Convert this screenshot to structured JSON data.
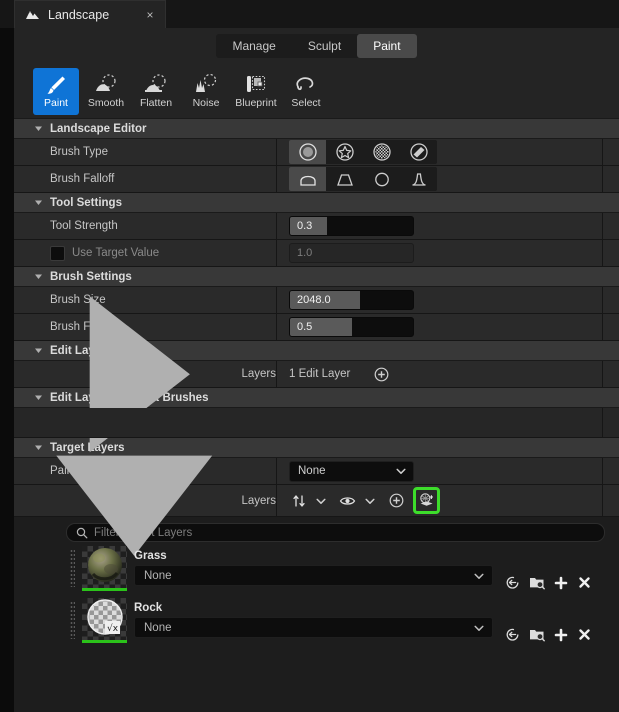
{
  "tab": {
    "title": "Landscape",
    "icon": "landscape-mountain-icon",
    "close": "×"
  },
  "modes": {
    "items": [
      {
        "label": "Manage",
        "active": false
      },
      {
        "label": "Sculpt",
        "active": false
      },
      {
        "label": "Paint",
        "active": true
      }
    ]
  },
  "tools": {
    "items": [
      {
        "label": "Paint",
        "icon": "paint-brush-icon",
        "active": true
      },
      {
        "label": "Smooth",
        "icon": "smooth-icon",
        "active": false
      },
      {
        "label": "Flatten",
        "icon": "flatten-icon",
        "active": false
      },
      {
        "label": "Noise",
        "icon": "noise-icon",
        "active": false
      },
      {
        "label": "Blueprint",
        "icon": "blueprint-icon",
        "active": false
      },
      {
        "label": "Select",
        "icon": "select-lasso-icon",
        "active": false
      }
    ]
  },
  "sections": {
    "landscape_editor": "Landscape Editor",
    "tool_settings": "Tool Settings",
    "brush_settings": "Brush Settings",
    "edit_layers": "Edit Layers",
    "edit_layer_bp_brushes": "Edit Layer Blueprint Brushes",
    "target_layers": "Target Layers"
  },
  "properties": {
    "brush_type": {
      "label": "Brush Type",
      "options": [
        {
          "icon": "brush-circle-icon",
          "active": true
        },
        {
          "icon": "brush-alpha-icon",
          "active": false
        },
        {
          "icon": "brush-pattern-icon",
          "active": false
        },
        {
          "icon": "brush-component-icon",
          "active": false
        }
      ]
    },
    "brush_falloff_type": {
      "label": "Brush Falloff",
      "options": [
        {
          "icon": "falloff-smooth-icon",
          "active": true
        },
        {
          "icon": "falloff-linear-icon",
          "active": false
        },
        {
          "icon": "falloff-spherical-icon",
          "active": false
        },
        {
          "icon": "falloff-tip-icon",
          "active": false
        }
      ]
    },
    "tool_strength": {
      "label": "Tool Strength",
      "value": "0.3",
      "fill_pct": 30
    },
    "use_target_value": {
      "label": "Use Target Value",
      "checked": false,
      "value": "1.0"
    },
    "brush_size": {
      "label": "Brush Size",
      "value": "2048.0",
      "fill_pct": 57
    },
    "brush_falloff": {
      "label": "Brush Falloff",
      "value": "0.5",
      "fill_pct": 50
    },
    "layers_edit": {
      "label": "Layers",
      "value": "1 Edit Layer",
      "add_icon": "plus-circle-icon"
    },
    "painting_restriction": {
      "label": "Painting Restriction",
      "value": "None"
    },
    "layers_target": {
      "label": "Layers",
      "tools": [
        {
          "icon": "sort-icon",
          "name": "sort-button"
        },
        {
          "icon": "chevron-down-icon",
          "name": "sort-dropdown"
        },
        {
          "icon": "eye-icon",
          "name": "visibility-button"
        },
        {
          "icon": "chevron-down-icon",
          "name": "visibility-dropdown"
        },
        {
          "icon": "plus-circle-icon",
          "name": "add-layer-button"
        },
        {
          "icon": "layers-stack-icon",
          "name": "target-layer-options-button",
          "highlighted": true
        }
      ],
      "highlight_color": "#3ddd2b"
    }
  },
  "target_layer_list": {
    "filter_placeholder": "Filter Target Layers",
    "search_icon": "search-icon",
    "layers": [
      {
        "name": "Grass",
        "material": "None",
        "thumbnail": "grass-material-sphere",
        "actions": [
          {
            "icon": "reset-arrow-icon",
            "name": "reset-layer-button"
          },
          {
            "icon": "browse-folder-icon",
            "name": "browse-to-asset-button"
          },
          {
            "icon": "plus-icon",
            "name": "create-layer-info-button"
          },
          {
            "icon": "close-x-icon",
            "name": "remove-layer-button"
          }
        ]
      },
      {
        "name": "Rock",
        "material": "None",
        "thumbnail": "rock-material-sphere",
        "actions": [
          {
            "icon": "reset-arrow-icon",
            "name": "reset-layer-button"
          },
          {
            "icon": "browse-folder-icon",
            "name": "browse-to-asset-button"
          },
          {
            "icon": "plus-icon",
            "name": "create-layer-info-button"
          },
          {
            "icon": "close-x-icon",
            "name": "remove-layer-button"
          }
        ]
      }
    ]
  }
}
